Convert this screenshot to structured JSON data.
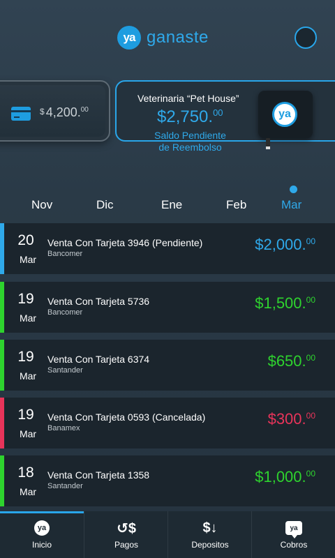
{
  "header": {
    "logo_badge": "ya",
    "app_name": "ganaste"
  },
  "cards": {
    "left": {
      "currency": "$",
      "amount": "4,200.",
      "cents": "00"
    },
    "main": {
      "merchant": "Veterinaria “Pet House”",
      "amount": "$2,750.",
      "cents": "00",
      "status_line1": "Saldo Pendiente",
      "status_line2": "de Reembolso",
      "device_badge": "ya"
    }
  },
  "months": [
    "Nov",
    "Dic",
    "Ene",
    "Feb",
    "Mar"
  ],
  "active_month": "Mar",
  "transactions": [
    {
      "day": "20",
      "month": "Mar",
      "description": "Venta Con Tarjeta 3946 (Pendiente)",
      "bank": "Bancomer",
      "amount": "$2,000.",
      "cents": "00",
      "color": "#2fa9ea"
    },
    {
      "day": "19",
      "month": "Mar",
      "description": "Venta Con Tarjeta 5736",
      "bank": "Bancomer",
      "amount": "$1,500.",
      "cents": "00",
      "color": "#2ed32e"
    },
    {
      "day": "19",
      "month": "Mar",
      "description": "Venta Con Tarjeta 6374",
      "bank": "Santander",
      "amount": "$650.",
      "cents": "00",
      "color": "#2ed32e"
    },
    {
      "day": "19",
      "month": "Mar",
      "description": "Venta Con Tarjeta 0593 (Cancelada)",
      "bank": "Banamex",
      "amount": "$300.",
      "cents": "00",
      "color": "#e8345a"
    },
    {
      "day": "18",
      "month": "Mar",
      "description": "Venta Con Tarjeta 1358",
      "bank": "Santander",
      "amount": "$1,000.",
      "cents": "00",
      "color": "#2ed32e"
    }
  ],
  "nav": [
    {
      "label": "Inicio",
      "icon": "ya-logo-icon",
      "glyph": "ya"
    },
    {
      "label": "Pagos",
      "icon": "pagos-icon",
      "glyph": "↺$"
    },
    {
      "label": "Depositos",
      "icon": "depositos-icon",
      "glyph": "$↓"
    },
    {
      "label": "Cobros",
      "icon": "cobros-icon",
      "glyph": "ya"
    }
  ],
  "colors": {
    "accent": "#2fa9ea",
    "positive": "#2ed32e",
    "cancelled": "#e8345a",
    "row_bg": "#1b252d"
  }
}
